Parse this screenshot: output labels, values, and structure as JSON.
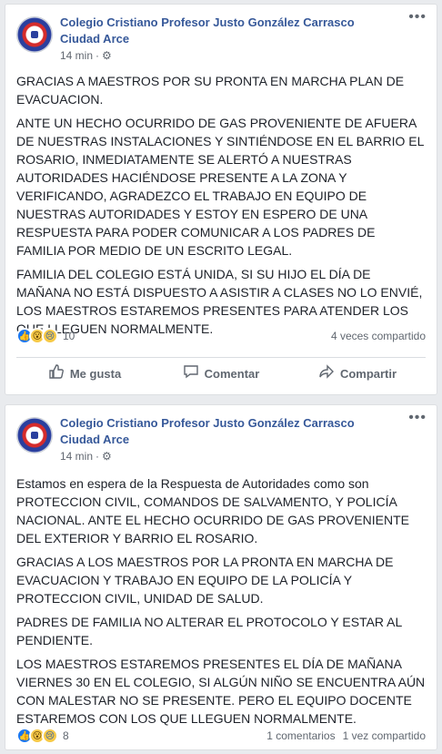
{
  "posts": [
    {
      "author": "Colegio Cristiano Profesor Justo González Carrasco Ciudad Arce",
      "time": "14 min",
      "paragraphs": [
        "GRACIAS A MAESTROS POR SU PRONTA EN MARCHA PLAN DE EVACUACION.",
        "ANTE UN HECHO OCURRIDO DE GAS PROVENIENTE DE AFUERA DE NUESTRAS INSTALACIONES Y SINTIÉNDOSE EN EL BARRIO EL ROSARIO, INMEDIATAMENTE SE ALERTÓ A NUESTRAS AUTORIDADES HACIÉNDOSE PRESENTE A LA ZONA Y VERIFICANDO, AGRADEZCO EL TRABAJO EN EQUIPO DE NUESTRAS AUTORIDADES Y ESTOY EN ESPERO DE UNA RESPUESTA PARA PODER COMUNICAR A LOS PADRES DE FAMILIA POR MEDIO DE UN ESCRITO LEGAL.",
        "FAMILIA DEL COLEGIO ESTÁ UNIDA, SI SU HIJO EL DÍA DE MAÑANA NO ESTÁ DISPUESTO A ASISTIR A CLASES NO LO ENVIÉ, LOS MAESTROS ESTAREMOS PRESENTES PARA ATENDER LOS QUE LLEGUEN NORMALMENTE."
      ],
      "reaction_count": "10",
      "comments": "",
      "shares": "4 veces compartido",
      "actions": {
        "like": "Me gusta",
        "comment": "Comentar",
        "share": "Compartir"
      }
    },
    {
      "author": "Colegio Cristiano Profesor Justo González Carrasco Ciudad Arce",
      "time": "14 min",
      "paragraphs": [
        "Estamos en espera de la Respuesta de Autoridades como son PROTECCION CIVIL, COMANDOS DE SALVAMENTO, Y POLICÍA NACIONAL. ANTE EL HECHO OCURRIDO DE GAS PROVENIENTE DEL EXTERIOR Y BARRIO EL ROSARIO.",
        "GRACIAS A LOS MAESTROS POR LA PRONTA EN MARCHA DE EVACUACION Y TRABAJO EN EQUIPO DE LA POLICÍA Y PROTECCION CIVIL, UNIDAD DE SALUD.",
        "PADRES DE FAMILIA NO ALTERAR EL PROTOCOLO Y ESTAR AL PENDIENTE.",
        "LOS MAESTROS ESTAREMOS PRESENTES EL DÍA DE MAÑANA VIERNES 30 EN EL COLEGIO, SI ALGÚN NIÑO SE ENCUENTRA AÚN CON MALESTAR NO SE PRESENTE. PERO EL EQUIPO DOCENTE ESTAREMOS CON LOS QUE LLEGUEN NORMALMENTE."
      ],
      "reaction_count": "8",
      "comments": "1 comentarios",
      "shares": "1 vez compartido"
    }
  ],
  "icons": {
    "like_reaction": "thumbs-up-icon",
    "wow_reaction": "wow-face-icon",
    "sad_reaction": "sad-face-icon",
    "audience": "gear-icon",
    "more": "more-options-icon"
  },
  "colors": {
    "author_link": "#365899",
    "background": "#e9ebee",
    "like_blue": "#1877f2"
  }
}
